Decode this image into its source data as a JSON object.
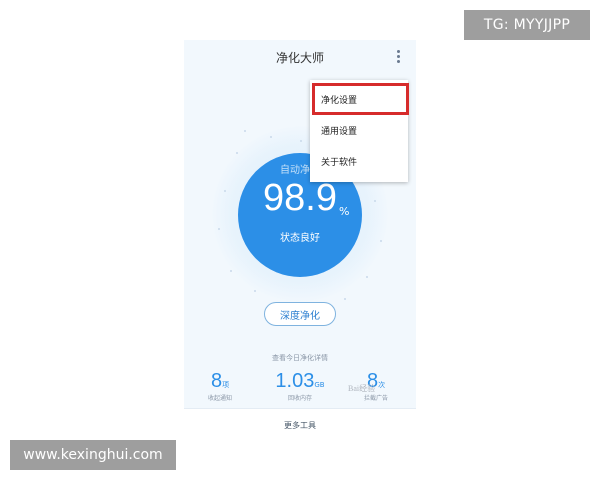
{
  "overlays": {
    "tg_label": "TG: MYYJJPP",
    "site_label": "www.kexinghui.com"
  },
  "app": {
    "title": "净化大师",
    "more_icon": "more-vertical-icon"
  },
  "menu": {
    "items": [
      {
        "label": "净化设置",
        "highlighted": true
      },
      {
        "label": "通用设置",
        "highlighted": false
      },
      {
        "label": "关于软件",
        "highlighted": false
      }
    ],
    "highlight_color": "#d62b2b"
  },
  "gauge": {
    "caption": "自动净化",
    "value": "98.9",
    "unit": "%",
    "status": "状态良好",
    "color": "#2c8fe7"
  },
  "deep_clean_label": "深度净化",
  "stats": {
    "link": "查看今日净化详情",
    "items": [
      {
        "value": "8",
        "unit": "项",
        "label": "收起通知"
      },
      {
        "value": "1.03",
        "unit": "GB",
        "label": "回收内存"
      },
      {
        "value": "8",
        "unit": "次",
        "label": "拦截广告"
      }
    ]
  },
  "bottom": {
    "more_tools_label": "更多工具"
  },
  "watermark_text": "Bai经验"
}
